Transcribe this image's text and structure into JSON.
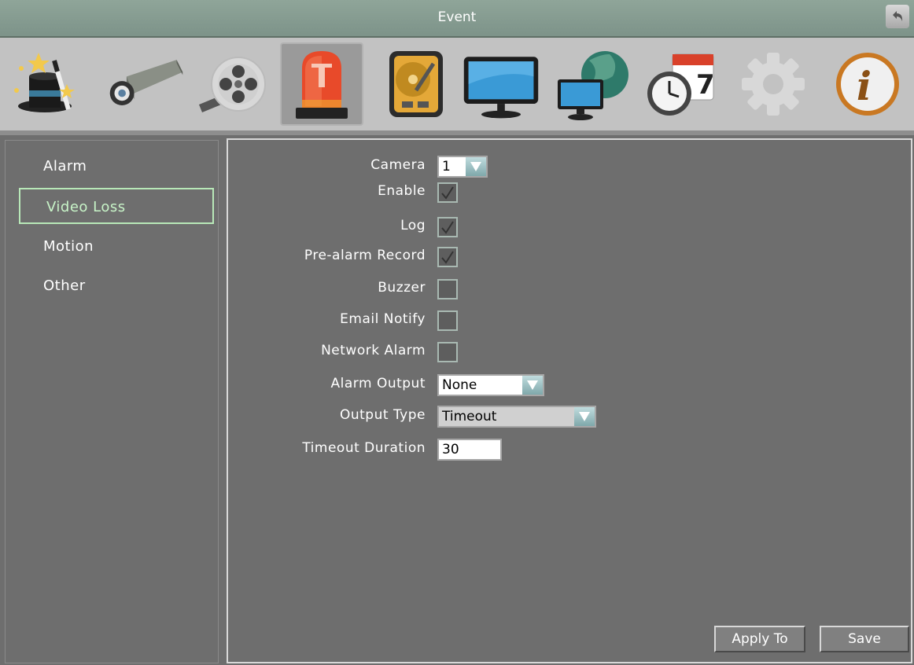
{
  "window": {
    "title": "Event"
  },
  "toolbar": {
    "icons": [
      "wizard-icon",
      "camera-icon",
      "record-icon",
      "event-alarm-icon",
      "storage-icon",
      "display-icon",
      "network-icon",
      "schedule-icon",
      "settings-icon",
      "info-icon"
    ],
    "active": "event-alarm-icon"
  },
  "sidebar": {
    "items": [
      {
        "label": "Alarm"
      },
      {
        "label": "Video Loss"
      },
      {
        "label": "Motion"
      },
      {
        "label": "Other"
      }
    ],
    "active": "Video Loss"
  },
  "form": {
    "camera": {
      "label": "Camera",
      "value": "1"
    },
    "enable": {
      "label": "Enable",
      "checked": true
    },
    "log": {
      "label": "Log",
      "checked": true
    },
    "pre_alarm_record": {
      "label": "Pre-alarm Record",
      "checked": true
    },
    "buzzer": {
      "label": "Buzzer",
      "checked": false
    },
    "email_notify": {
      "label": "Email Notify",
      "checked": false
    },
    "network_alarm": {
      "label": "Network Alarm",
      "checked": false
    },
    "alarm_output": {
      "label": "Alarm Output",
      "value": "None"
    },
    "output_type": {
      "label": "Output Type",
      "value": "Timeout"
    },
    "timeout_duration": {
      "label": "Timeout Duration",
      "value": "30"
    }
  },
  "buttons": {
    "apply_to": "Apply To",
    "save": "Save"
  },
  "colors": {
    "accent": "#b8e8b8",
    "titlebar": "#8fa599",
    "panel": "#6e6e6e"
  }
}
